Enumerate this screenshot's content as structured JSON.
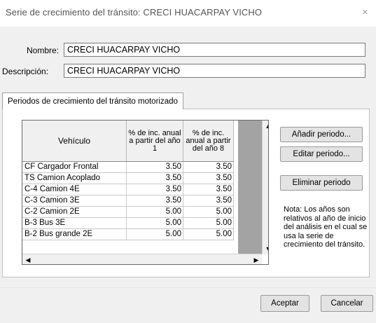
{
  "window": {
    "title": "Serie de crecimiento del tránsito: CRECI HUACARPAY VICHO",
    "close_glyph": "×"
  },
  "form": {
    "name_label": "Nombre:",
    "name_value": "CRECI HUACARPAY VICHO",
    "description_label": "Descripción:",
    "description_value": "CRECI HUACARPAY VICHO"
  },
  "tab": {
    "label": "Periodos de crecimiento del tránsito motorizado"
  },
  "grid": {
    "columns": [
      "Vehículo",
      "% de inc. anual a partir del año 1",
      "% de inc. anual a partir del año 8"
    ],
    "rows": [
      [
        "CF Cargador Frontal",
        "3.50",
        "3.50"
      ],
      [
        "TS Camion Acoplado",
        "3.50",
        "3.50"
      ],
      [
        "C-4 Camion 4E",
        "3.50",
        "3.50"
      ],
      [
        "C-3 Camion 3E",
        "3.50",
        "3.50"
      ],
      [
        "C-2 Camion 2E",
        "5.00",
        "5.00"
      ],
      [
        "B-3 Bus 3E",
        "5.00",
        "5.00"
      ],
      [
        "B-2 Bus grande 2E",
        "5.00",
        "5.00"
      ]
    ]
  },
  "buttons": {
    "add_period": "Añadir periodo...",
    "edit_period": "Editar periodo...",
    "delete_period": "Eliminar periodo",
    "accept": "Aceptar",
    "cancel": "Cancelar"
  },
  "note": "Nota: Los años son relativos al año de inicio del análisis en el cual se usa la serie de crecimiento del tránsito."
}
